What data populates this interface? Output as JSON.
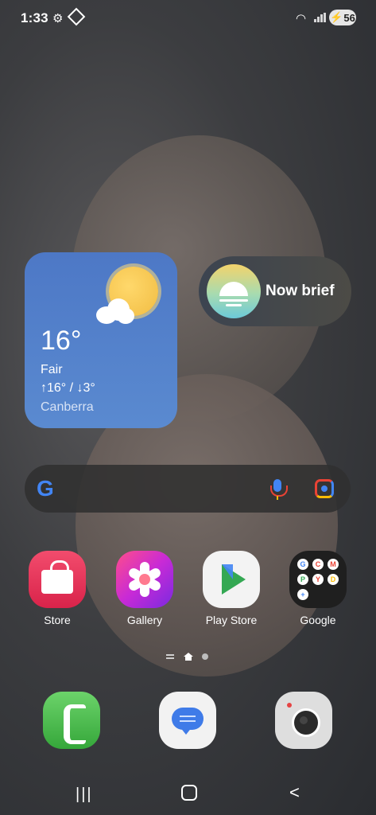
{
  "status_bar": {
    "time": "1:33",
    "battery": "56",
    "icons": [
      "settings-gear-icon",
      "diamond-notification-icon",
      "wifi-icon",
      "signal-icon",
      "charging-bolt-icon"
    ]
  },
  "weather": {
    "temp": "16°",
    "condition": "Fair",
    "hi_lo": "↑16° / ↓3°",
    "city": "Canberra",
    "icon": "sun-cloud-icon"
  },
  "now_brief": {
    "label": "Now brief"
  },
  "search": {
    "logo": "G",
    "icons": [
      "mic-icon",
      "lens-icon"
    ]
  },
  "apps": [
    {
      "label": "Store"
    },
    {
      "label": "Gallery"
    },
    {
      "label": "Play Store"
    },
    {
      "label": "Google"
    }
  ],
  "google_folder_minis": [
    "G",
    "C",
    "M",
    "P",
    "Y",
    "D",
    "+"
  ],
  "dock": [
    {
      "name": "Phone"
    },
    {
      "name": "Messages"
    },
    {
      "name": "Camera"
    }
  ],
  "nav": {
    "recent": "|||",
    "back": "<"
  }
}
